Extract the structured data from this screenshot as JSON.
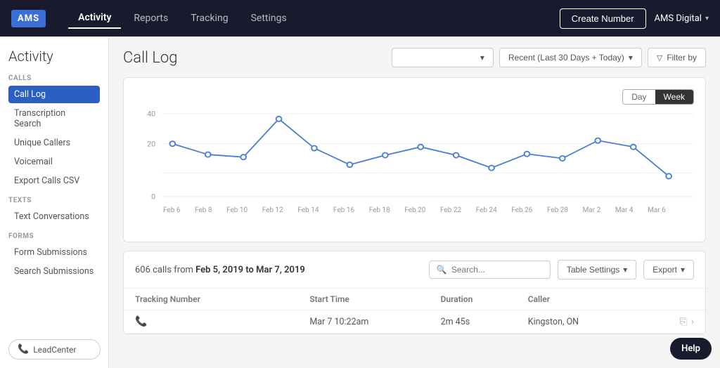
{
  "brand": {
    "logo_text": "AMS",
    "logo_color": "#3a6fd8"
  },
  "nav": {
    "items": [
      {
        "label": "Activity",
        "active": true
      },
      {
        "label": "Reports",
        "active": false
      },
      {
        "label": "Tracking",
        "active": false
      },
      {
        "label": "Settings",
        "active": false
      }
    ],
    "create_button_label": "Create Number",
    "user_name": "AMS Digital"
  },
  "sidebar": {
    "title": "Activity",
    "sections": [
      {
        "label": "CALLS",
        "items": [
          {
            "label": "Call Log",
            "active": true
          },
          {
            "label": "Transcription Search",
            "active": false
          },
          {
            "label": "Unique Callers",
            "active": false
          },
          {
            "label": "Voicemail",
            "active": false
          },
          {
            "label": "Export Calls CSV",
            "active": false
          }
        ]
      },
      {
        "label": "TEXTS",
        "items": [
          {
            "label": "Text Conversations",
            "active": false
          }
        ]
      },
      {
        "label": "FORMS",
        "items": [
          {
            "label": "Form Submissions",
            "active": false
          },
          {
            "label": "Search Submissions",
            "active": false
          }
        ]
      }
    ],
    "lead_center_label": "LeadCenter"
  },
  "content": {
    "title": "Call Log",
    "filter_dropdown_placeholder": "",
    "recent_label": "Recent (Last 30 Days + Today)",
    "filter_by_label": "Filter by",
    "chart": {
      "toggle_day": "Day",
      "toggle_week": "Week",
      "y_labels": [
        "0",
        "20",
        "40"
      ],
      "x_labels": [
        "Feb 6",
        "Feb 8",
        "Feb 10",
        "Feb 12",
        "Feb 14",
        "Feb 16",
        "Feb 18",
        "Feb 20",
        "Feb 22",
        "Feb 24",
        "Feb 26",
        "Feb 28",
        "Mar 2",
        "Mar 4",
        "Mar 6"
      ]
    },
    "table": {
      "summary_prefix": "606 calls from",
      "date_range": "Feb 5, 2019 to Mar 7, 2019",
      "search_placeholder": "Search...",
      "table_settings_label": "Table Settings",
      "export_label": "Export",
      "columns": [
        "Tracking Number",
        "Start Time",
        "Duration",
        "Caller"
      ],
      "rows": [
        {
          "tracking": "",
          "start_time": "Mar 7 10:22am",
          "duration": "2m 45s",
          "caller": "Kingston, ON"
        }
      ]
    }
  }
}
